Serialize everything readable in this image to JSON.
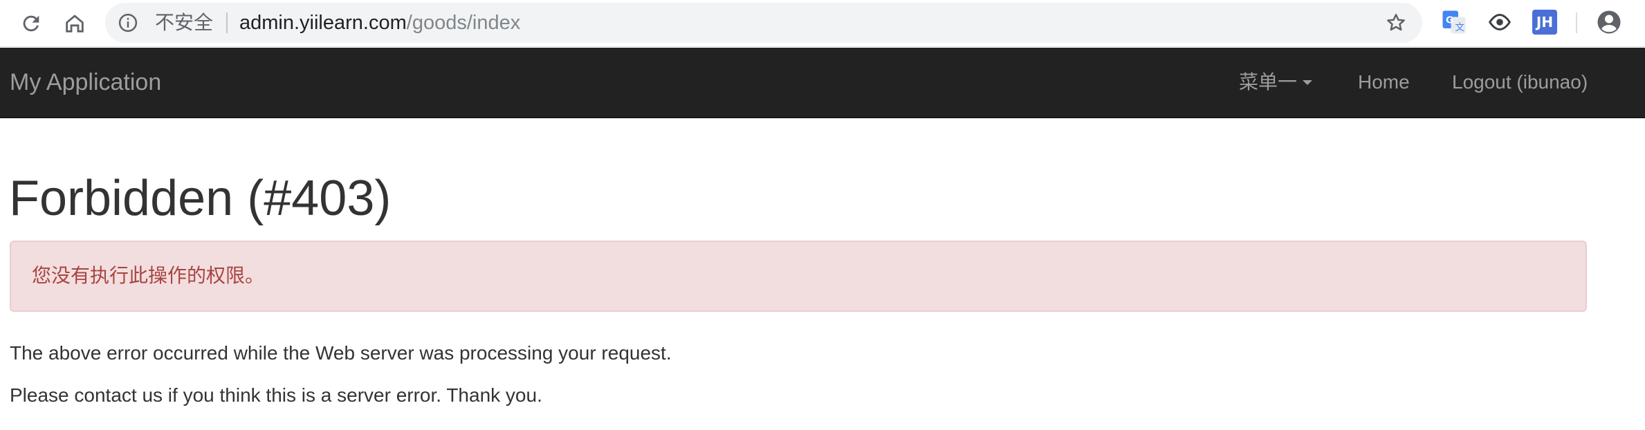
{
  "browser": {
    "security_label": "不安全",
    "url_host": "admin.yiilearn.com",
    "url_path": "/goods/index",
    "icons": [
      "reload-icon",
      "home-icon",
      "info-icon",
      "star-icon",
      "translate-icon",
      "eye-icon",
      "jh-extension-icon",
      "profile-icon"
    ],
    "ext_jh_label": "JH"
  },
  "navbar": {
    "brand": "My Application",
    "menu_dropdown": "菜单一",
    "home": "Home",
    "logout": "Logout (ibunao)"
  },
  "content": {
    "title": "Forbidden (#403)",
    "alert": "您没有执行此操作的权限。",
    "paragraph1": "The above error occurred while the Web server was processing your request.",
    "paragraph2": "Please contact us if you think this is a server error. Thank you."
  },
  "colors": {
    "navbar_bg": "#222222",
    "nav_text": "#9d9d9d",
    "alert_bg": "#f2dede",
    "alert_border": "#ebccd1",
    "alert_text": "#a94442"
  }
}
